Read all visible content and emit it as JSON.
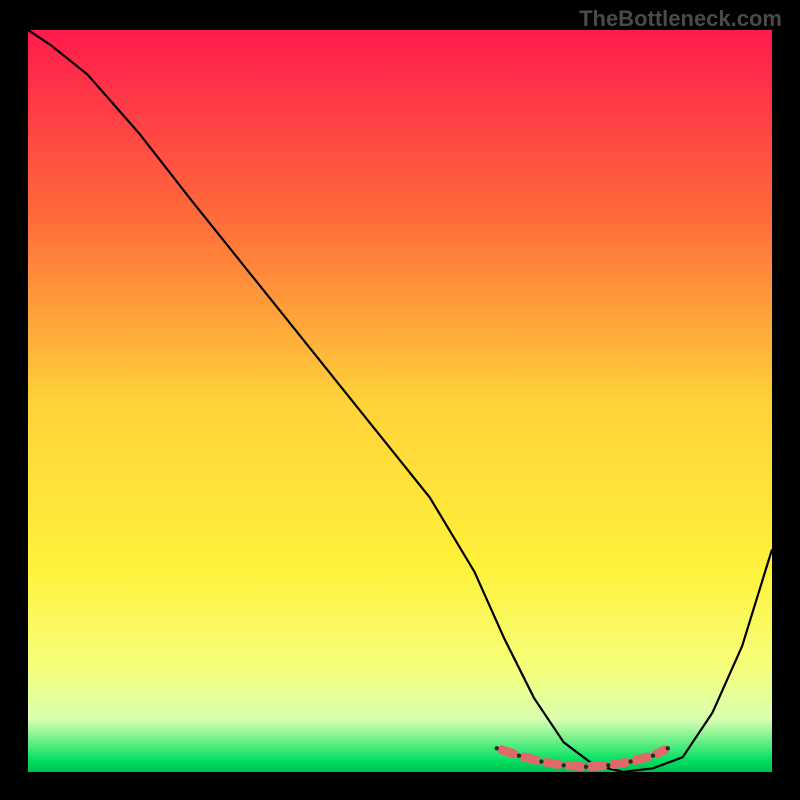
{
  "watermark": "TheBottleneck.com",
  "chart_data": {
    "type": "line",
    "title": "",
    "xlabel": "",
    "ylabel": "",
    "xlim": [
      0,
      100
    ],
    "ylim": [
      0,
      100
    ],
    "background_gradient": {
      "stops": [
        {
          "pos": 0.0,
          "color": "#ff1a4d"
        },
        {
          "pos": 0.25,
          "color": "#ff6a3a"
        },
        {
          "pos": 0.5,
          "color": "#ffd23a"
        },
        {
          "pos": 0.72,
          "color": "#fff13a"
        },
        {
          "pos": 0.86,
          "color": "#f6ff7a"
        },
        {
          "pos": 0.93,
          "color": "#d7ffb0"
        },
        {
          "pos": 0.985,
          "color": "#00e060"
        },
        {
          "pos": 1.0,
          "color": "#00c050"
        }
      ]
    },
    "series": [
      {
        "name": "bottleneck-curve",
        "x": [
          0,
          3,
          8,
          15,
          22,
          30,
          38,
          46,
          54,
          60,
          64,
          68,
          72,
          76,
          80,
          84,
          88,
          92,
          96,
          100
        ],
        "y": [
          100,
          98,
          94,
          86,
          77,
          67,
          57,
          47,
          37,
          27,
          18,
          10,
          4,
          1,
          0,
          0.5,
          2,
          8,
          17,
          30
        ]
      }
    ],
    "markers": {
      "name": "highlight-band",
      "color": "#e06a6a",
      "points": [
        {
          "x": 63,
          "y": 3.2
        },
        {
          "x": 66,
          "y": 2.2
        },
        {
          "x": 69,
          "y": 1.4
        },
        {
          "x": 72,
          "y": 0.9
        },
        {
          "x": 75,
          "y": 0.7
        },
        {
          "x": 78,
          "y": 0.9
        },
        {
          "x": 81,
          "y": 1.4
        },
        {
          "x": 84,
          "y": 2.2
        },
        {
          "x": 86,
          "y": 3.2
        }
      ]
    }
  }
}
